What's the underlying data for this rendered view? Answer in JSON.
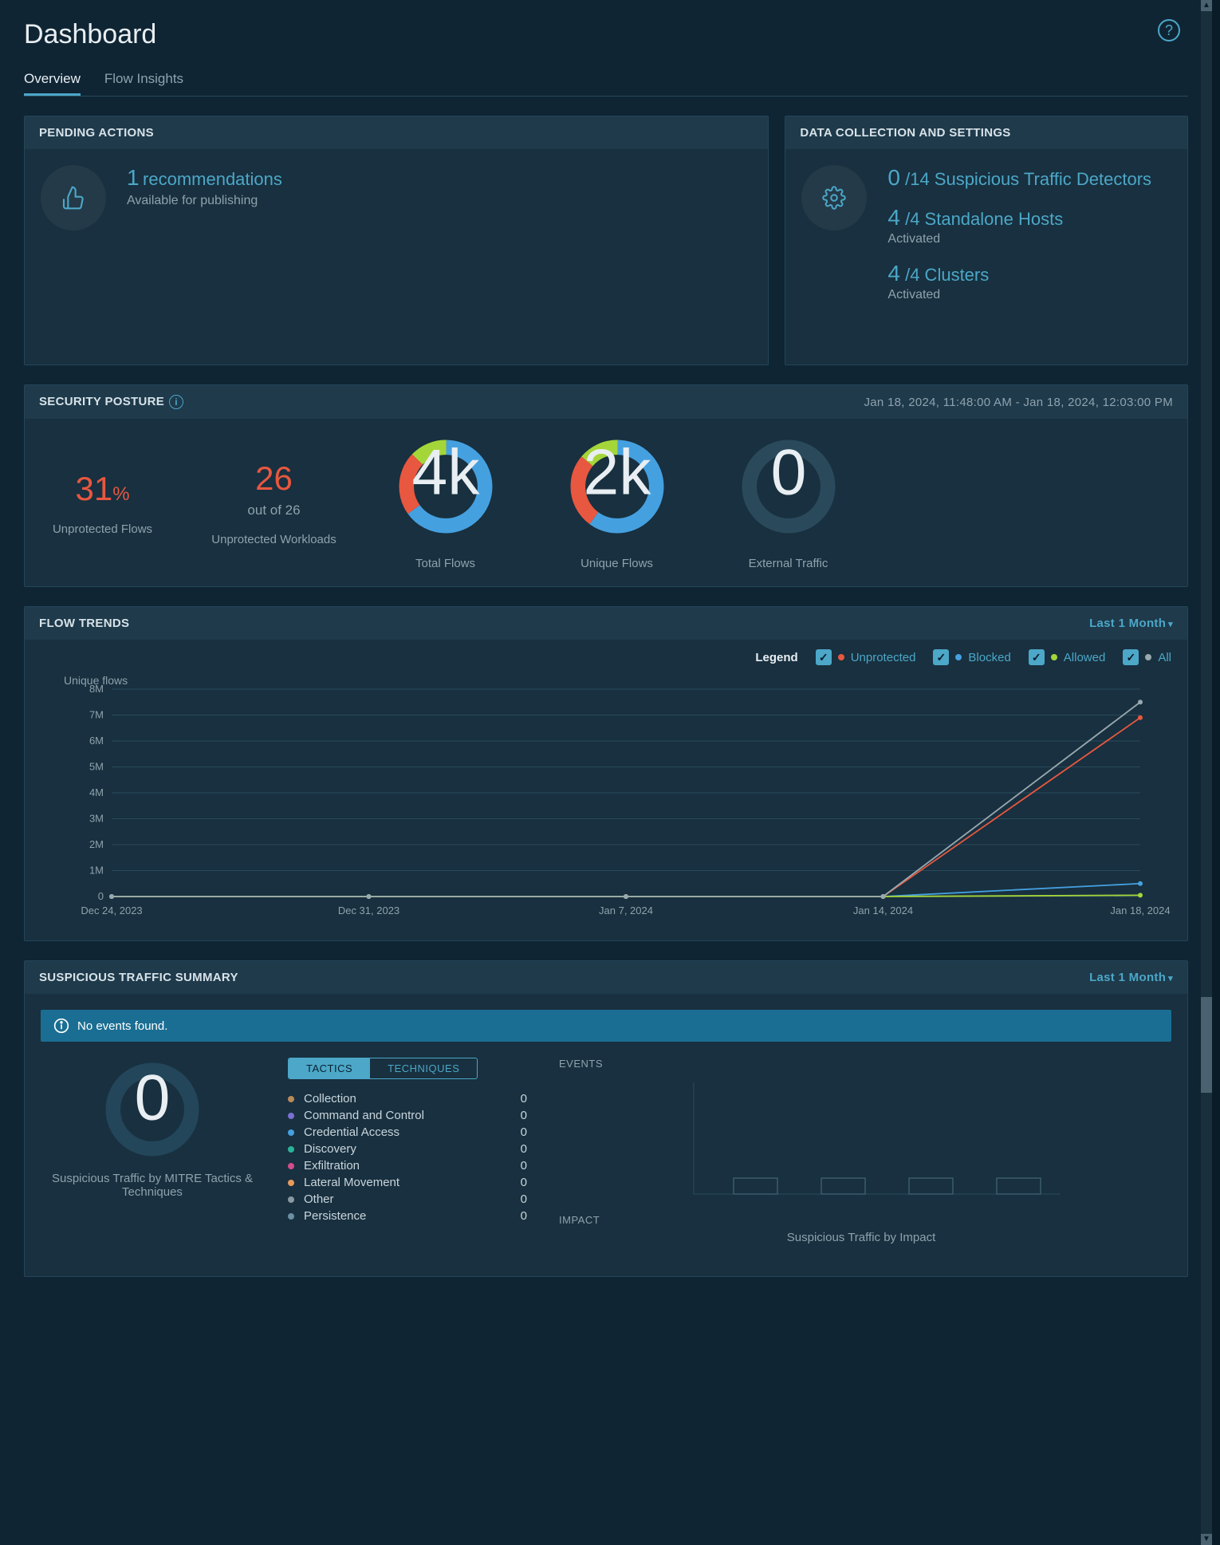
{
  "page": {
    "title": "Dashboard"
  },
  "tabs": [
    {
      "label": "Overview",
      "active": true
    },
    {
      "label": "Flow Insights",
      "active": false
    }
  ],
  "pending": {
    "header": "PENDING ACTIONS",
    "count": "1",
    "label": "recommendations",
    "sub": "Available for publishing"
  },
  "datacoll": {
    "header": "DATA COLLECTION AND SETTINGS",
    "items": [
      {
        "big": "0",
        "rest": "/14 Suspicious Traffic Detectors",
        "sub": ""
      },
      {
        "big": "4",
        "rest": "/4 Standalone Hosts",
        "sub": "Activated"
      },
      {
        "big": "4",
        "rest": "/4 Clusters",
        "sub": "Activated"
      }
    ]
  },
  "posture": {
    "header": "SECURITY POSTURE",
    "timestamp": "Jan 18, 2024, 11:48:00 AM - Jan 18, 2024, 12:03:00 PM",
    "unprotected_flows": {
      "value": "31",
      "unit": "%",
      "label": "Unprotected Flows"
    },
    "unprotected_workloads": {
      "value": "26",
      "sub": "out of 26",
      "label": "Unprotected Workloads"
    },
    "total_flows": {
      "value": "4k",
      "label": "Total Flows"
    },
    "unique_flows": {
      "value": "2k",
      "label": "Unique Flows"
    },
    "external_traffic": {
      "value": "0",
      "label": "External Traffic"
    }
  },
  "chart_data": {
    "type": "line",
    "title": "FLOW TRENDS",
    "range_selector": "Last 1 Month",
    "legend_label": "Legend",
    "ylabel": "Unique flows",
    "ylim": [
      0,
      8000000
    ],
    "yticks": [
      "0",
      "1M",
      "2M",
      "3M",
      "4M",
      "5M",
      "6M",
      "7M",
      "8M"
    ],
    "x": [
      "Dec 24, 2023",
      "Dec 31, 2023",
      "Jan 7, 2024",
      "Jan 14, 2024",
      "Jan 18, 2024"
    ],
    "series": [
      {
        "name": "Unprotected",
        "color": "#e8573f",
        "values": [
          0,
          0,
          0,
          0,
          6900000
        ]
      },
      {
        "name": "Blocked",
        "color": "#45a0e0",
        "values": [
          0,
          0,
          0,
          0,
          500000
        ]
      },
      {
        "name": "Allowed",
        "color": "#a5d639",
        "values": [
          0,
          0,
          0,
          0,
          50000
        ]
      },
      {
        "name": "All",
        "color": "#9aa8af",
        "values": [
          0,
          0,
          0,
          0,
          7500000
        ]
      }
    ]
  },
  "suspicious": {
    "header": "SUSPICIOUS TRAFFIC SUMMARY",
    "range_selector": "Last 1 Month",
    "banner": "No events found.",
    "donut_center": "0",
    "donut_label": "Suspicious Traffic by MITRE Tactics & Techniques",
    "tabs": {
      "tactics": "TACTICS",
      "techniques": "TECHNIQUES"
    },
    "tactics": [
      {
        "name": "Collection",
        "value": "0",
        "color": "#b88b5a"
      },
      {
        "name": "Command and Control",
        "value": "0",
        "color": "#7a6fd1"
      },
      {
        "name": "Credential Access",
        "value": "0",
        "color": "#45a0e0"
      },
      {
        "name": "Discovery",
        "value": "0",
        "color": "#2bb39a"
      },
      {
        "name": "Exfiltration",
        "value": "0",
        "color": "#d14d8b"
      },
      {
        "name": "Lateral Movement",
        "value": "0",
        "color": "#e89a5a"
      },
      {
        "name": "Other",
        "value": "0",
        "color": "#8a9aa3"
      },
      {
        "name": "Persistence",
        "value": "0",
        "color": "#6b8fa3"
      }
    ],
    "events_label": "EVENTS",
    "impact_label": "IMPACT",
    "impact_chart_label": "Suspicious Traffic by Impact"
  }
}
